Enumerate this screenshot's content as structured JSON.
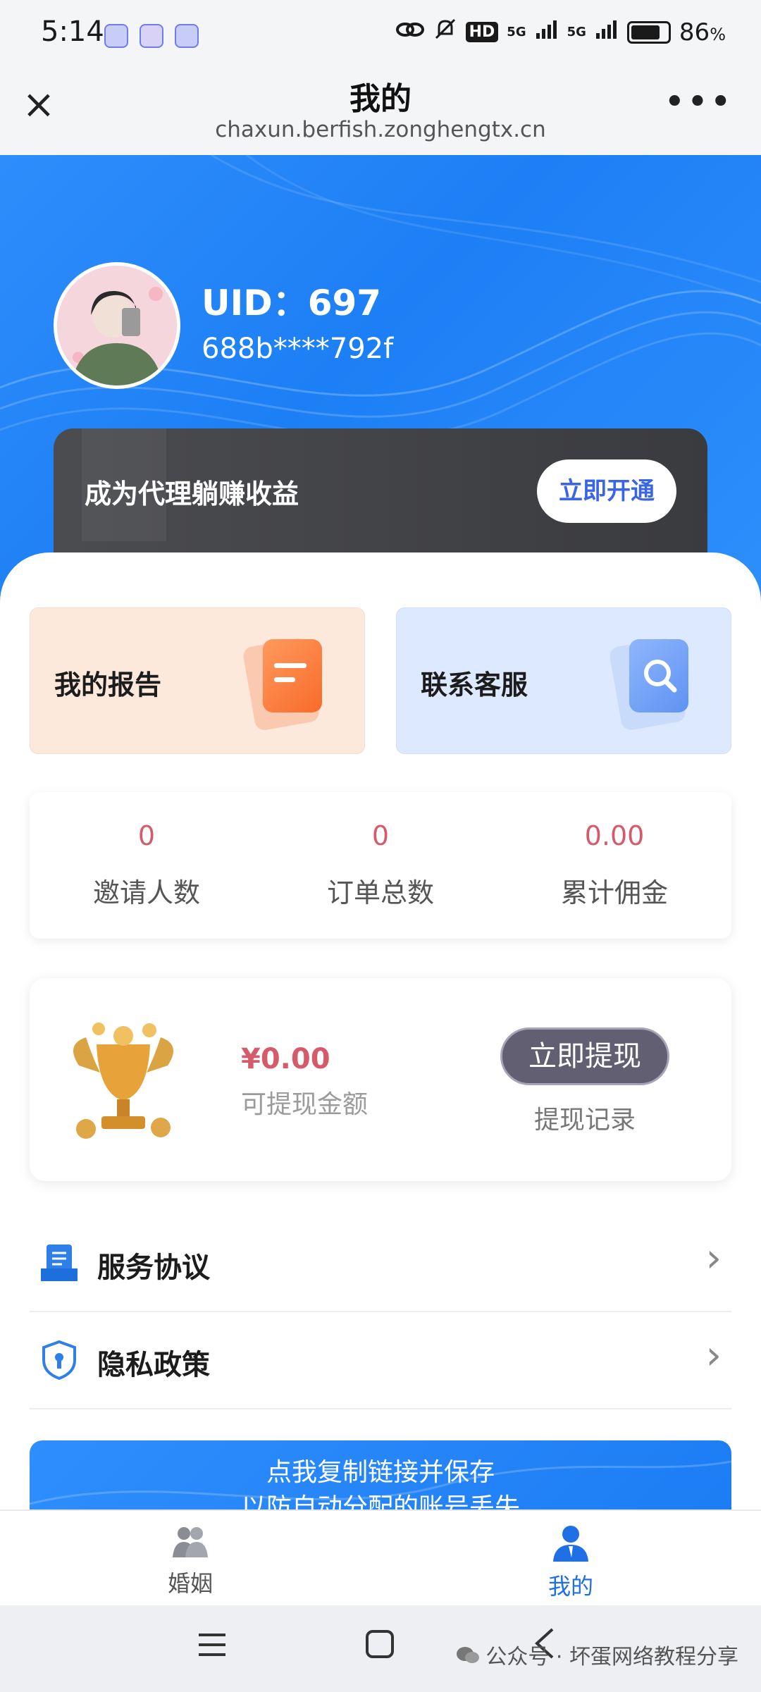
{
  "status_bar": {
    "time": "5:14",
    "network_hd": "HD",
    "network_5g_1": "5G",
    "network_5g_2": "5G",
    "battery": "86",
    "battery_unit": "%"
  },
  "titlebar": {
    "title": "我的",
    "url": "chaxun.berfish.zonghengtx.cn",
    "close_icon": "close-icon",
    "more_icon": "more-icon"
  },
  "profile": {
    "uid": "UID：697",
    "account": "688b****792f"
  },
  "agent_card": {
    "text": "成为代理躺赚收益",
    "button": "立即开通"
  },
  "quick_actions": [
    {
      "label": "我的报告",
      "icon": "report-icon"
    },
    {
      "label": "联系客服",
      "icon": "service-search-icon"
    }
  ],
  "stats": [
    {
      "value": "0",
      "label": "邀请人数"
    },
    {
      "value": "0",
      "label": "订单总数"
    },
    {
      "value": "0.00",
      "label": "累计佣金"
    }
  ],
  "wallet": {
    "amount": "¥0.00",
    "amount_label": "可提现金额",
    "withdraw_button": "立即提现",
    "withdraw_record": "提现记录"
  },
  "menu": [
    {
      "label": "服务协议",
      "icon": "document-icon"
    },
    {
      "label": "隐私政策",
      "icon": "shield-lock-icon"
    }
  ],
  "copy_banner": {
    "line1": "点我复制链接并保存",
    "line2": "以防自动分配的账号丢失"
  },
  "bottom_nav": [
    {
      "label": "婚姻",
      "icon": "couple-icon",
      "active": false
    },
    {
      "label": "我的",
      "icon": "user-icon",
      "active": true
    }
  ],
  "watermark": "公众号 · 坏蛋网络教程分享",
  "colors": {
    "primary_blue": "#1d7ff5",
    "accent_red": "#d55b6b",
    "active_nav": "#1f6fe5"
  }
}
